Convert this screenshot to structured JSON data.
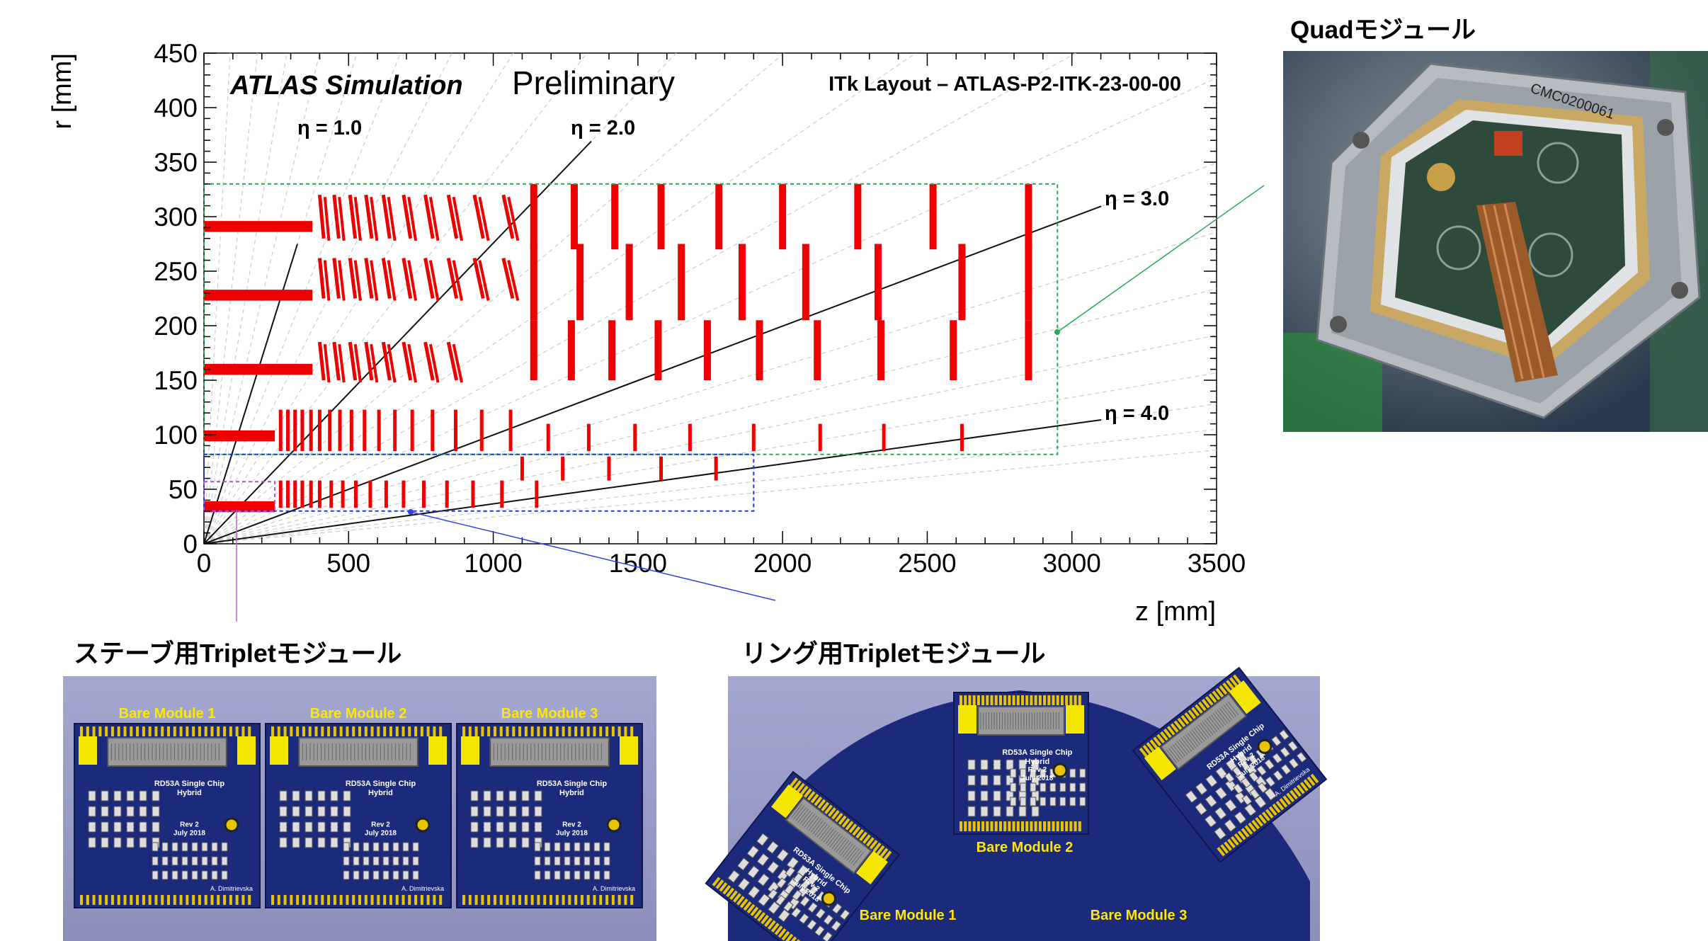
{
  "plot": {
    "xlabel": "z [mm]",
    "ylabel": "r [mm]",
    "xticks": [
      "0",
      "500",
      "1000",
      "1500",
      "2000",
      "2500",
      "3000",
      "3500"
    ],
    "yticks": [
      "0",
      "50",
      "100",
      "150",
      "200",
      "250",
      "300",
      "350",
      "400",
      "450"
    ],
    "title_bold": "ATLAS Simulation",
    "title_normal": "Preliminary",
    "layout_label": "ITk Layout – ATLAS-P2-ITK-23-00-00",
    "eta_labels": [
      "η = 1.0",
      "η = 2.0",
      "η = 3.0",
      "η = 4.0"
    ]
  },
  "chart_data": {
    "type": "scatter",
    "xlim": [
      0,
      3500
    ],
    "ylim": [
      0,
      450
    ],
    "eta_values": [
      1.0,
      2.0,
      3.0,
      4.0
    ],
    "barrel_layers_r": [
      34,
      99,
      160,
      228,
      291
    ],
    "barrel_layers_zmax": [
      245,
      245,
      375,
      375,
      375
    ],
    "outer_ring_z": [
      1140,
      1280,
      1420,
      1580,
      1780,
      2000,
      2260,
      2520,
      2850
    ],
    "outer_ring_r_ranges": [
      [
        150,
        205
      ],
      [
        205,
        275
      ],
      [
        270,
        330
      ]
    ],
    "inner_ring_z": [
      265,
      310,
      355,
      410,
      465,
      530,
      600,
      680,
      765,
      860,
      970,
      1100,
      1250,
      1420,
      1620,
      1850,
      2100,
      2340,
      2620
    ],
    "inner_ring_r_ranges": [
      [
        33,
        58
      ],
      [
        85,
        123
      ]
    ],
    "regions": {
      "quad_box": {
        "z": [
          0,
          2950
        ],
        "r": [
          82,
          330
        ],
        "color": "#22aa55"
      },
      "ring_triplet_box": {
        "z": [
          0,
          1900
        ],
        "r": [
          30,
          82
        ],
        "color": "#2233dd"
      },
      "stave_triplet_box": {
        "z": [
          0,
          245
        ],
        "r": [
          30,
          57
        ],
        "color": "#aa55cc"
      }
    },
    "colors": {
      "modules": "#ee0000",
      "eta_lines": "#111111",
      "helper_lines": "#cccccc"
    }
  },
  "quad": {
    "title": "Quadモジュール",
    "photo_text": "CMC0200061"
  },
  "stave": {
    "title": "ステーブ用Tripletモジュール",
    "bare_labels": [
      "Bare Module 1",
      "Bare Module 2",
      "Bare Module 3"
    ],
    "chip_title": "RD53A Single Chip",
    "chip_subtitle": "Hybrid",
    "rev": "Rev 2",
    "date": "July 2018",
    "author": "A. Dimitrievska"
  },
  "ring": {
    "title": "リング用Tripletモジュール",
    "bare_labels": [
      "Bare Module 1",
      "Bare Module 2",
      "Bare Module 3"
    ],
    "chip_title": "RD53A Single Chip",
    "chip_subtitle": "Hybrid",
    "rev": "Rev 2",
    "date": "July 2018",
    "author": "A. Dimitrievska"
  }
}
